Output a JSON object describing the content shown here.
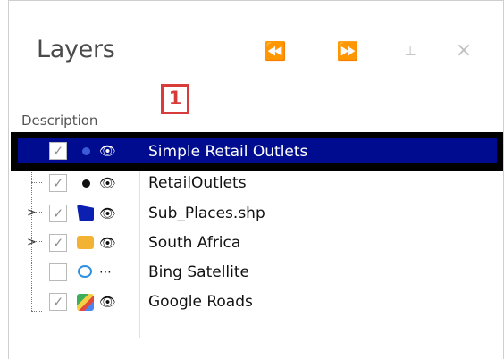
{
  "panel": {
    "title": "Layers",
    "buttons": {
      "back": "⏪",
      "forward": "⏩",
      "pin": "⊥",
      "close": "×"
    },
    "callout_number": "1",
    "column_header": "Description",
    "layers": [
      {
        "label": "Simple Retail Outlets",
        "checked": true,
        "selected": true,
        "icon": "blue-dot-icon"
      },
      {
        "label": "RetailOutlets",
        "checked": true,
        "selected": false,
        "icon": "black-dot-icon"
      },
      {
        "label": "Sub_Places.shp",
        "checked": true,
        "selected": false,
        "icon": "polygon-icon"
      },
      {
        "label": "South Africa",
        "checked": true,
        "selected": false,
        "icon": "folder-icon"
      },
      {
        "label": "Bing Satellite",
        "checked": false,
        "selected": false,
        "icon": "bing-icon"
      },
      {
        "label": "Google Roads",
        "checked": true,
        "selected": false,
        "icon": "google-map-icon"
      }
    ],
    "colors": {
      "selection": "#000c8f",
      "callout": "#d93a3a"
    }
  }
}
